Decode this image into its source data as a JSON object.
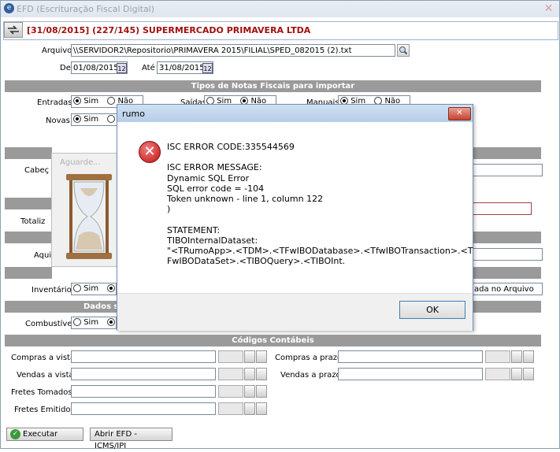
{
  "window": {
    "title": "EFD (Escrituração Fiscal Digital)",
    "close": "✕"
  },
  "header": {
    "title": "[31/08/2015] (227/145) SUPERMERCADO PRIMAVERA LTDA"
  },
  "arquivo": {
    "label": "Arquivo",
    "value": "\\\\SERVIDOR2\\Repositorio\\PRIMAVERA 2015\\FILIAL\\SPED_082015 (2).txt"
  },
  "periodo": {
    "de_label": "De",
    "de_value": "01/08/2015",
    "ate_label": "Até",
    "ate_value": "31/08/2015"
  },
  "tipos": {
    "section": "Tipos de Notas Fiscais para importar",
    "entradas_label": "Entradas",
    "saidas_label": "Saídas",
    "manuais_label": "Manuais",
    "novas_label": "Novas",
    "sim": "Sim",
    "nao": "Não"
  },
  "left_labels": {
    "cabecalho": "Cabeç",
    "totalizadores": "Totaliz",
    "arquivo2": "Aqui"
  },
  "inventario": {
    "label": "Inventário",
    "sim": "Sim",
    "right_text": "ada no Arquivo"
  },
  "dados": {
    "section": "Dados s",
    "combustiveis_label": "Combustíveis",
    "sim": "Sim"
  },
  "codigos": {
    "section": "Códigos Contábeis",
    "compras_vista": "Compras a vista",
    "compras_prazo": "Compras a prazo",
    "vendas_vista": "Vendas a vista",
    "vendas_prazo": "Vendas a prazo",
    "fretes_tomados": "Fretes Tomados",
    "fretes_emitidos": "Fretes Emitidos"
  },
  "footer": {
    "executar": "Executar",
    "abrir": "Abrir EFD - ICMS/IPI"
  },
  "aguarde": {
    "title": "Aguarde..."
  },
  "rumo": {
    "title": "rumo",
    "message": "ISC ERROR CODE:335544569\n\nISC ERROR MESSAGE:\nDynamic SQL Error\nSQL error code = -104\nToken unknown - line 1, column 122\n)\n\nSTATEMENT:\nTIBOInternalDataset:\n\"<TRumoApp>.<TDM>.<TFwIBODatabase>.<TfwIBOTransaction>.<T\nFwIBODataSet>.<TIBOQuery>.<TIBOInt.",
    "ok": "OK"
  }
}
